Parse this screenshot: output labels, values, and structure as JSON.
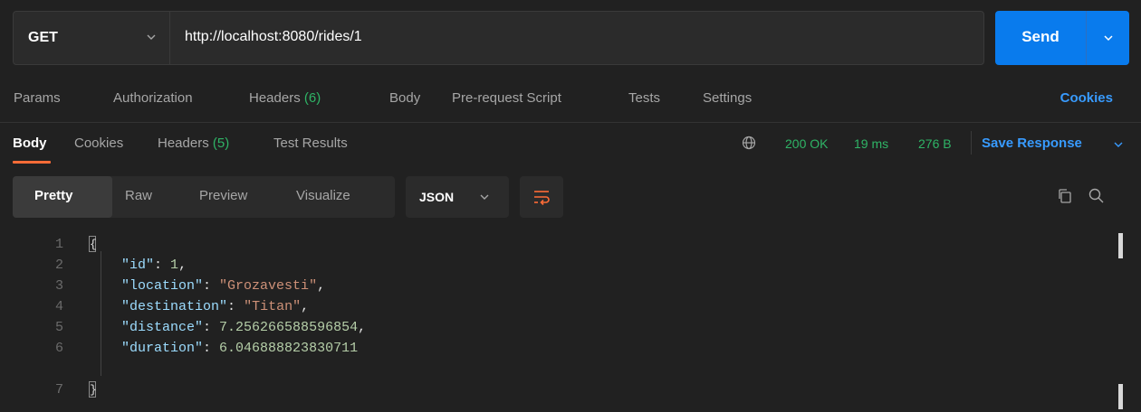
{
  "request": {
    "method": "GET",
    "url": "http://localhost:8080/rides/1",
    "send_label": "Send"
  },
  "request_tabs": [
    {
      "label": "Params"
    },
    {
      "label": "Authorization"
    },
    {
      "label": "Headers",
      "count": "(6)"
    },
    {
      "label": "Body"
    },
    {
      "label": "Pre-request Script"
    },
    {
      "label": "Tests"
    },
    {
      "label": "Settings"
    }
  ],
  "cookies_link": "Cookies",
  "response_tabs": [
    {
      "label": "Body"
    },
    {
      "label": "Cookies"
    },
    {
      "label": "Headers",
      "count": "(5)"
    },
    {
      "label": "Test Results"
    }
  ],
  "response_meta": {
    "status": "200 OK",
    "time": "19 ms",
    "size": "276 B",
    "save_label": "Save Response"
  },
  "format_tabs": [
    "Pretty",
    "Raw",
    "Preview",
    "Visualize"
  ],
  "language": "JSON",
  "code": {
    "open_brace": "{",
    "close_brace": "}",
    "fields": [
      {
        "key": "\"id\"",
        "value": "1",
        "comma": ","
      },
      {
        "key": "\"location\"",
        "value": "\"Grozavesti\"",
        "comma": ","
      },
      {
        "key": "\"destination\"",
        "value": "\"Titan\"",
        "comma": ","
      },
      {
        "key": "\"distance\"",
        "value": "7.256266588596854",
        "comma": ","
      },
      {
        "key": "\"duration\"",
        "value": "6.046888823830711",
        "comma": ""
      }
    ],
    "line_numbers": [
      "1",
      "2",
      "3",
      "4",
      "5",
      "6",
      "7"
    ]
  },
  "colors": {
    "accent_blue": "#097bed",
    "link_blue": "#389bff",
    "active_orange": "#ff6c37",
    "status_green": "#2fb466"
  }
}
